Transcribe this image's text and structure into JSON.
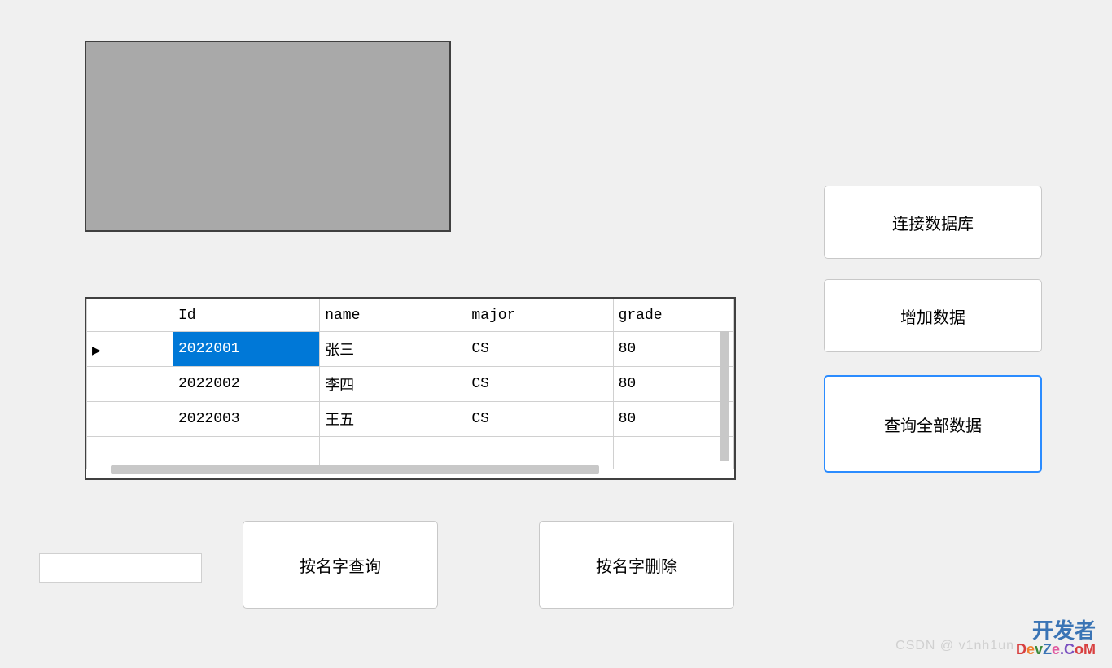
{
  "columns": {
    "id": "Id",
    "name": "name",
    "major": "major",
    "grade": "grade"
  },
  "rows": [
    {
      "indicator": "▶",
      "id": "2022001",
      "name": "张三",
      "major": "CS",
      "grade": "80",
      "selected": true
    },
    {
      "indicator": "",
      "id": "2022002",
      "name": "李四",
      "major": "CS",
      "grade": "80",
      "selected": false
    },
    {
      "indicator": "",
      "id": "2022003",
      "name": "王五",
      "major": "CS",
      "grade": "80",
      "selected": false
    }
  ],
  "buttons": {
    "connect": "连接数据库",
    "add": "增加数据",
    "query_all": "查询全部数据",
    "query_by_name": "按名字查询",
    "delete_by_name": "按名字删除"
  },
  "input": {
    "value": ""
  },
  "watermark": {
    "line1": "开发者",
    "line2_chars": [
      "D",
      "e",
      "v",
      "Z",
      "e",
      ".C",
      "oM"
    ],
    "csdn": "CSDN @ v1nh1un"
  }
}
